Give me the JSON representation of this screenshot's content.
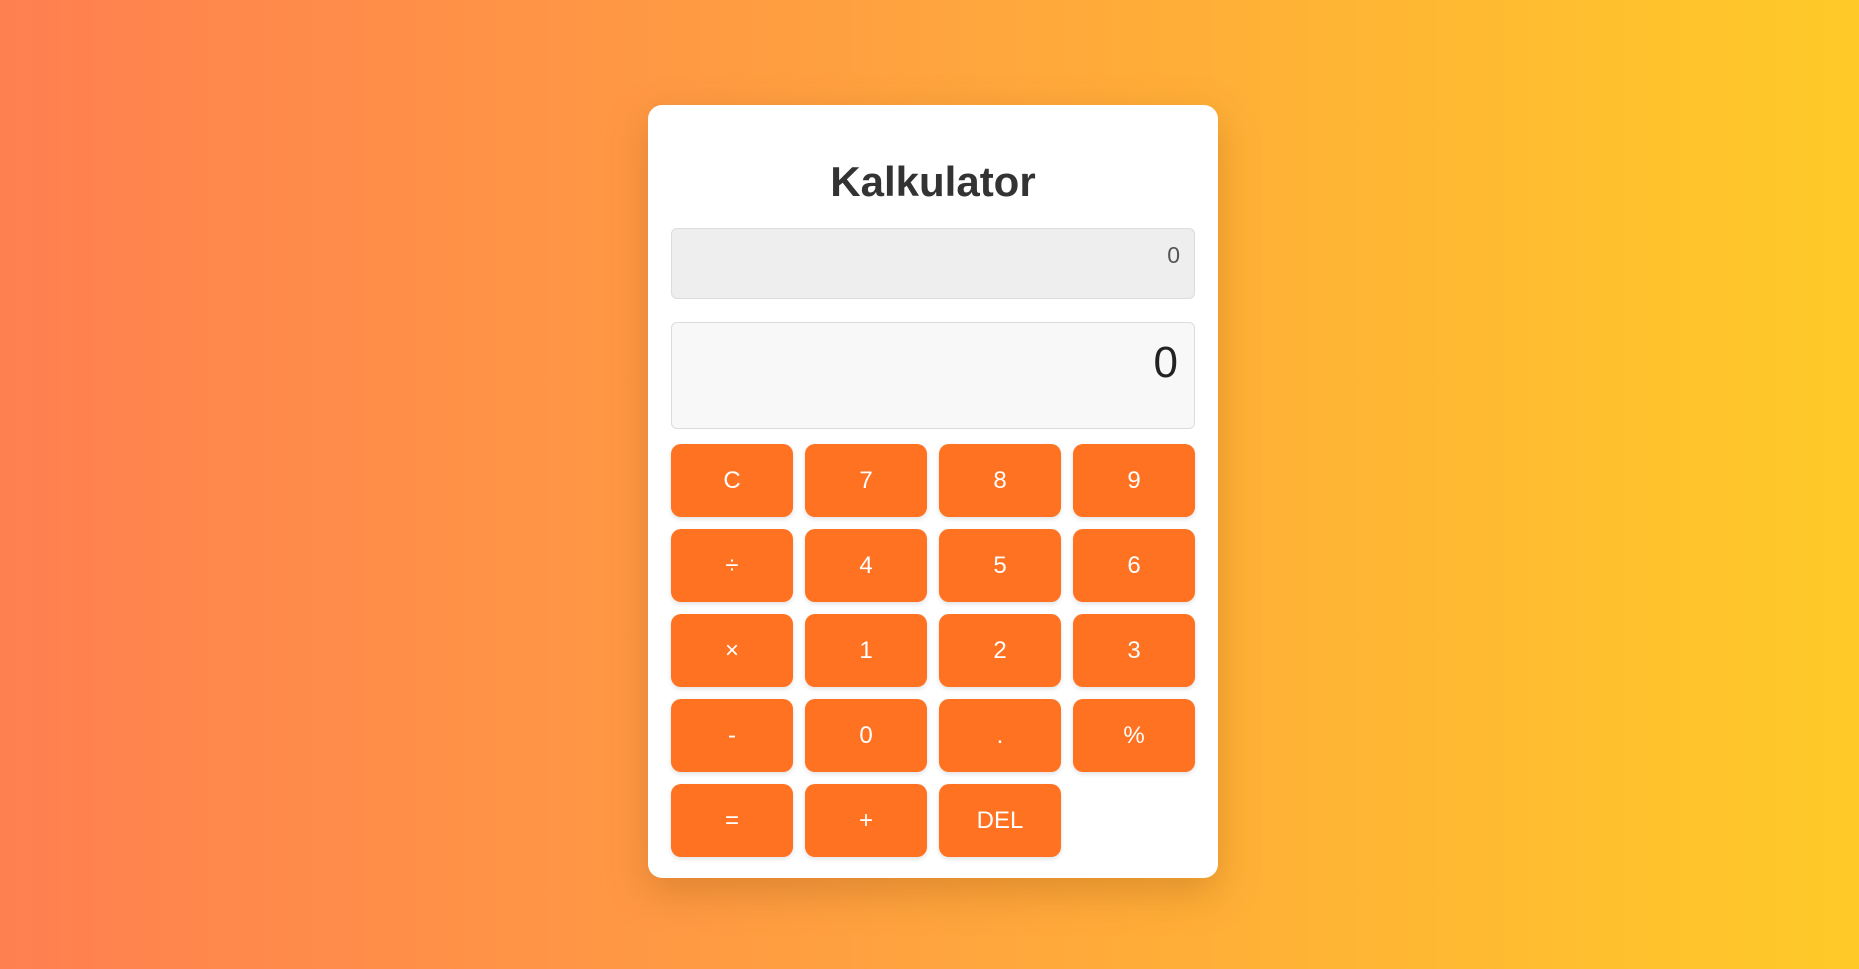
{
  "app": {
    "title": "Kalkulator"
  },
  "history": {
    "value": "0"
  },
  "display": {
    "value": "0"
  },
  "keys": {
    "clear": "C",
    "seven": "7",
    "eight": "8",
    "nine": "9",
    "divide": "÷",
    "four": "4",
    "five": "5",
    "six": "6",
    "multiply": "×",
    "one": "1",
    "two": "2",
    "three": "3",
    "subtract": "-",
    "zero": "0",
    "decimal": ".",
    "percent": "%",
    "equals": "=",
    "add": "+",
    "delete": "DEL"
  },
  "colors": {
    "accent": "#ff7222",
    "background_start": "#ff7f50",
    "background_end": "#ffca28"
  }
}
